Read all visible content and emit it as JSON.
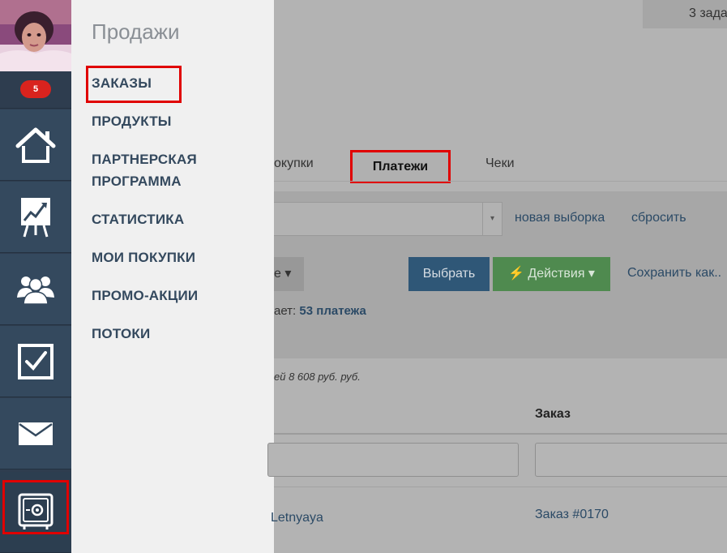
{
  "sidebar": {
    "notification_count": "5",
    "items": [
      {
        "icon": "home-icon"
      },
      {
        "icon": "chart-board-icon"
      },
      {
        "icon": "users-icon"
      },
      {
        "icon": "checkbox-icon"
      },
      {
        "icon": "envelope-icon"
      },
      {
        "icon": "safe-icon"
      }
    ]
  },
  "flyout": {
    "title": "Продажи",
    "items": [
      {
        "label": "ЗАКАЗЫ"
      },
      {
        "label": "ПРОДУКТЫ"
      },
      {
        "label": "ПАРТНЕРСКАЯ"
      },
      {
        "label": "ПРОГРАММА"
      },
      {
        "label": "СТАТИСТИКА"
      },
      {
        "label": "МОИ ПОКУПКИ"
      },
      {
        "label": "ПРОМО-АКЦИИ"
      },
      {
        "label": "ПОТОКИ"
      }
    ]
  },
  "header": {
    "tasks_label": "3 зада"
  },
  "tabs": {
    "purchases": "окупки",
    "payments": "Платежи",
    "receipts": "Чеки"
  },
  "filters": {
    "select_arrow": "▾",
    "new_selection": "новая выборка",
    "reset": "сбросить",
    "sort_label": "е ▾",
    "select_button": "Выбрать",
    "actions_button": "⚡ Действия ▾",
    "save_as": "Сохранить как..",
    "found_prefix": "ает: ",
    "found_count": "53 платежа"
  },
  "table": {
    "sum_text": "ей  8 608 руб. руб.",
    "column_order": "Заказ",
    "rows": [
      {
        "name": "Letnyaya",
        "order": "Заказ #0170"
      }
    ]
  },
  "colors": {
    "sidebar_bg": "#34495e",
    "highlight": "#e00000",
    "badge": "#d9231e"
  }
}
